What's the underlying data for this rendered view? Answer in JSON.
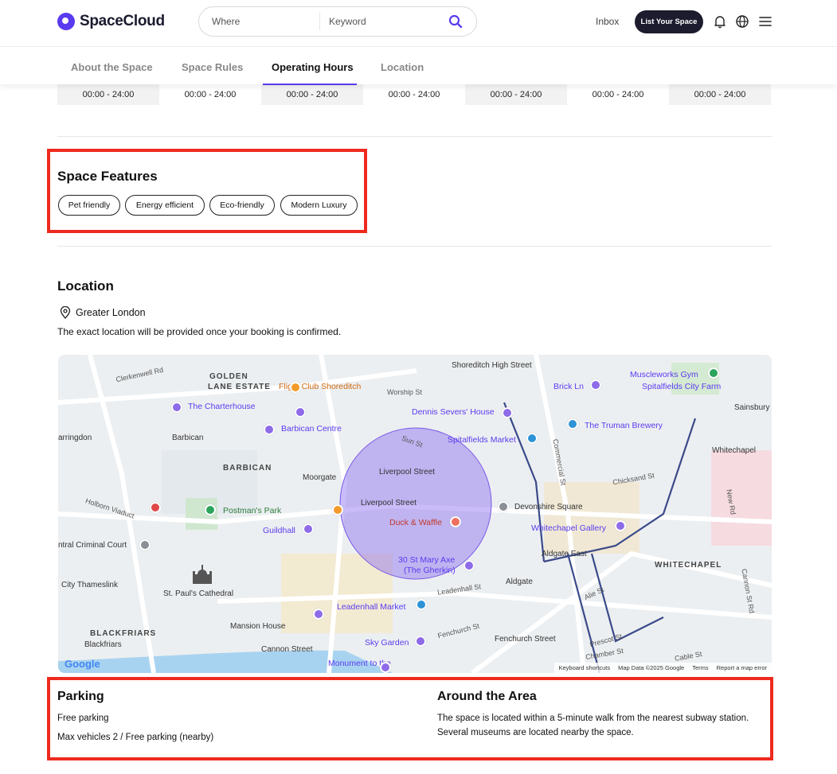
{
  "header": {
    "brand": "SpaceCloud",
    "search": {
      "where_placeholder": "Where",
      "keyword_placeholder": "Keyword"
    },
    "inbox": "Inbox",
    "list_button": "List Your Space"
  },
  "tabs": [
    {
      "label": "About the Space"
    },
    {
      "label": "Space Rules"
    },
    {
      "label": "Operating Hours",
      "active": true
    },
    {
      "label": "Location"
    }
  ],
  "hours": [
    "00:00 - 24:00",
    "00:00 - 24:00",
    "00:00 - 24:00",
    "00:00 - 24:00",
    "00:00 - 24:00",
    "00:00 - 24:00",
    "00:00 - 24:00"
  ],
  "features": {
    "title": "Space Features",
    "tags": [
      "Pet friendly",
      "Energy efficient",
      "Eco-friendly",
      "Modern Luxury"
    ]
  },
  "location": {
    "title": "Location",
    "area": "Greater London",
    "note": "The exact location will be provided once your booking is confirmed."
  },
  "map": {
    "labels": {
      "golden_lane": "GOLDEN",
      "golden_lane2": "LANE ESTATE",
      "barbican_area": "BARBICAN",
      "blackfriars_area": "BLACKFRIARS",
      "whitechapel_area": "WHITECHAPEL",
      "flight_club": "Flight Club Shoreditch",
      "charterhouse": "The Charterhouse",
      "barbican_centre": "Barbican Centre",
      "barbican": "Barbican",
      "dennis": "Dennis Severs' House",
      "spitalfields": "Spitalfields Market",
      "truman": "The Truman Brewery",
      "brick_ln": "Brick Ln",
      "muscleworks": "Muscleworks Gym",
      "city_farm": "Spitalfields City Farm",
      "sainsbury": "Sainsbury",
      "whitechapel": "Whitechapel",
      "shoreditch_high": "Shoreditch High Street",
      "farringdon": "arringdon",
      "moorgate": "Moorgate",
      "liverpool1": "Liverpool Street",
      "liverpool2": "Liverpool Street",
      "postmans": "Postman's Park",
      "guildhall": "Guildhall",
      "duck": "Duck & Waffle",
      "devonshire": "Devonshire Square",
      "whitechapel_gallery": "Whitechapel Gallery",
      "aldgate_east": "Aldgate East",
      "aldgate": "Aldgate",
      "gherkin1": "30 St Mary Axe",
      "gherkin2": "(The Gherkin)",
      "criminal": "ntral Criminal Court",
      "thameslink": "City Thameslink",
      "stpauls": "St. Paul's Cathedral",
      "leadenhall": "Leadenhall Market",
      "mansion": "Mansion House",
      "blackfriars": "Blackfriars",
      "cannon": "Cannon Street",
      "sky_garden": "Sky Garden",
      "fenchurch": "Fenchurch Street",
      "monument": "Monument to the",
      "clerkenwell": "Clerkenwell Rd",
      "worship": "Worship St",
      "sun_st": "Sun St",
      "holborn": "Holborn Viaduct",
      "leadenhall_st": "Leadenhall St",
      "fenchurch_st": "Fenchurch St",
      "commercial_st": "Commercial St",
      "chicksand": "Chicksand St",
      "new_rd": "New Rd",
      "cannon_st_rd": "Cannon St Rd",
      "cable_st": "Cable St",
      "prescot": "Prescot St",
      "chamber": "Chamber St",
      "alie": "Alie St"
    },
    "footer": {
      "keyboard": "Keyboard shortcuts",
      "mapdata": "Map Data ©2025 Google",
      "terms": "Terms",
      "report": "Report a map error"
    },
    "google": "Google"
  },
  "parking": {
    "title": "Parking",
    "line1": "Free parking",
    "line2": "Max vehicles 2 / Free parking (nearby)"
  },
  "around": {
    "title": "Around the Area",
    "text": "The space is located within a 5-minute walk from the nearest subway station. Several museums are located nearby the space."
  },
  "colors": {
    "accent": "#5a3bf0",
    "highlight": "#ee2a1f",
    "dark_button": "#1c1c2e"
  }
}
